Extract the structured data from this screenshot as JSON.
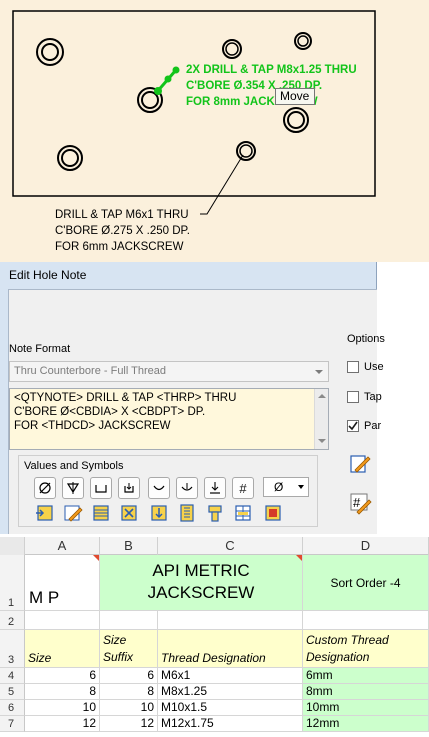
{
  "drawing": {
    "note_green_lines": [
      "2X  DRILL & TAP M8x1.25 THRU",
      "C'BORE Ø.354 X .250 DP.",
      "FOR 8mm JACKSCREW"
    ],
    "note_black_lines": [
      "DRILL & TAP M6x1 THRU",
      "C'BORE Ø.275 X .250 DP.",
      "FOR 6mm JACKSCREW"
    ],
    "tooltip": "Move",
    "colors": {
      "background": "#fbf0dc",
      "highlight": "#12c41a"
    }
  },
  "dialog": {
    "title": "Edit Hole Note",
    "note_format_label": "Note Format",
    "note_format_value": "Thru Counterbore - Full Thread",
    "note_text_lines": [
      "<QTYNOTE> DRILL & TAP <THRP> THRU",
      "C'BORE Ø<CBDIA> X <CBDPT> DP.",
      "FOR <THDCD> JACKSCREW"
    ],
    "values_label": "Values and Symbols",
    "symbol_select_value": "Ø",
    "options": {
      "label": "Options",
      "items": [
        {
          "label": "Use",
          "checked": false
        },
        {
          "label": "Tap",
          "checked": false
        },
        {
          "label": "Par",
          "checked": true
        }
      ]
    }
  },
  "sheet": {
    "columns": [
      "A",
      "B",
      "C",
      "D"
    ],
    "row_numbers": [
      "1",
      "2",
      "3",
      "4",
      "5",
      "6",
      "7"
    ],
    "row1": {
      "a": "M P",
      "c_line1": "API METRIC",
      "c_line2": "JACKSCREW",
      "d": "Sort Order -4"
    },
    "headers": {
      "size": "Size",
      "suffix_line1": "Size",
      "suffix_line2": "Suffix",
      "thread": "Thread Designation",
      "custom_line1": "Custom Thread",
      "custom_line2": "Designation"
    },
    "rows": [
      {
        "size": "6",
        "suffix": "6",
        "thread": "M6x1",
        "custom": "6mm"
      },
      {
        "size": "8",
        "suffix": "8",
        "thread": "M8x1.25",
        "custom": "8mm"
      },
      {
        "size": "10",
        "suffix": "10",
        "thread": "M10x1.5",
        "custom": "10mm"
      },
      {
        "size": "12",
        "suffix": "12",
        "thread": "M12x1.75",
        "custom": "12mm"
      }
    ],
    "colors": {
      "yellow": "#ffffcc",
      "green": "#ccffcc"
    }
  }
}
